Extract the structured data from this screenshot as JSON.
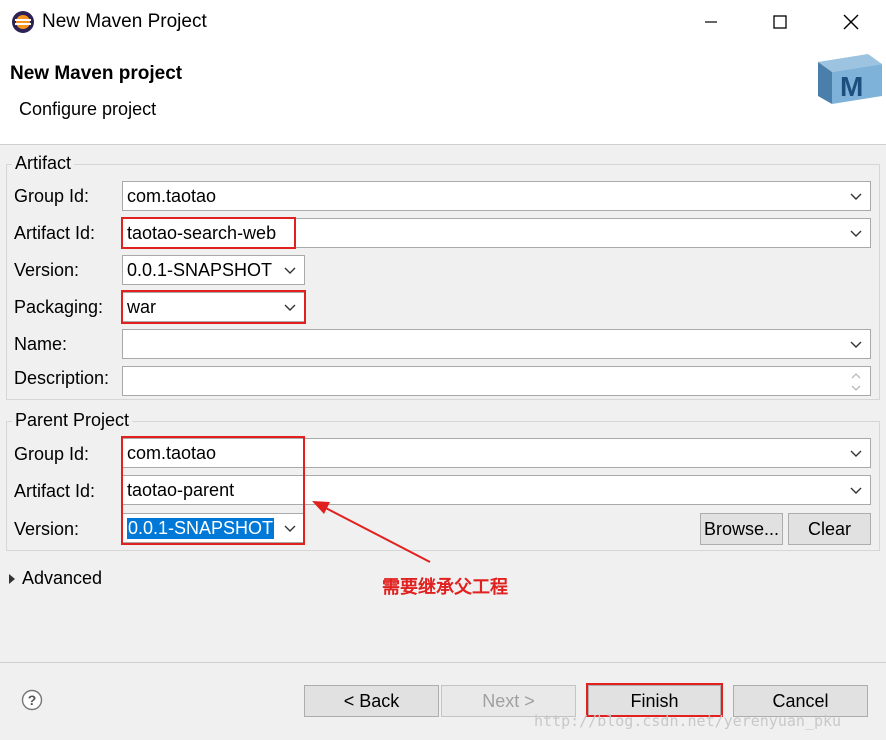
{
  "window": {
    "title": "New Maven Project",
    "app_icon": "eclipse-icon",
    "controls": [
      "minimize-icon",
      "maximize-icon",
      "close-icon"
    ]
  },
  "header": {
    "title": "New Maven project",
    "subtitle": "Configure project",
    "logo_letter": "M"
  },
  "artifact": {
    "legend": "Artifact",
    "group_id": {
      "label": "Group Id:",
      "value": "com.taotao"
    },
    "artifact_id": {
      "label": "Artifact Id:",
      "value": "taotao-search-web"
    },
    "version": {
      "label": "Version:",
      "value": "0.0.1-SNAPSHOT"
    },
    "packaging": {
      "label": "Packaging:",
      "value": "war"
    },
    "name": {
      "label": "Name:",
      "value": ""
    },
    "description": {
      "label": "Description:",
      "value": ""
    }
  },
  "parent": {
    "legend": "Parent Project",
    "group_id": {
      "label": "Group Id:",
      "value": "com.taotao"
    },
    "artifact_id": {
      "label": "Artifact Id:",
      "value": "taotao-parent"
    },
    "version": {
      "label": "Version:",
      "value": "0.0.1-SNAPSHOT"
    },
    "browse_label": "Browse...",
    "clear_label": "Clear"
  },
  "advanced": {
    "label": "Advanced"
  },
  "annotation": {
    "text": "需要继承父工程",
    "color": "#e0211f"
  },
  "footer": {
    "help_icon": "help-icon",
    "back_label": "< Back",
    "next_label": "Next >",
    "finish_label": "Finish",
    "cancel_label": "Cancel",
    "watermark": "http://blog.csdn.net/yerenyuan_pku"
  },
  "colors": {
    "highlight": "#e0211f",
    "selection": "#0078d7",
    "dialog_bg": "#f0f0f0"
  }
}
